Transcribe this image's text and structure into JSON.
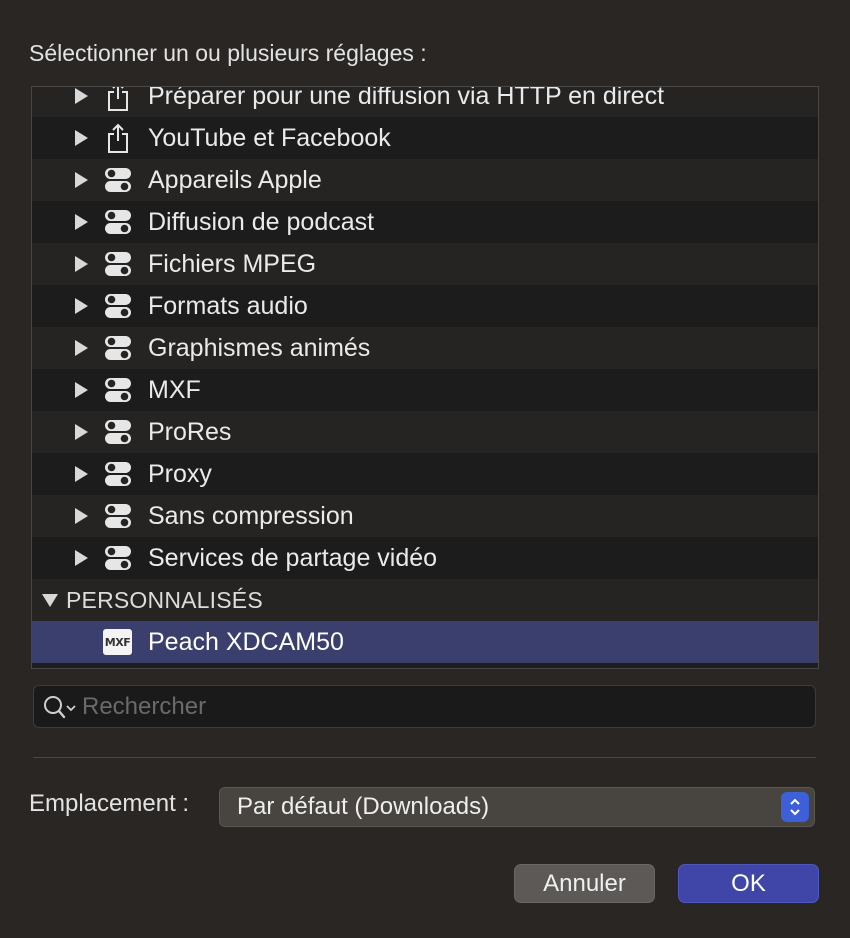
{
  "header": {
    "title": "Sélectionner un ou plusieurs réglages :"
  },
  "presets": [
    {
      "label": "Préparer pour une diffusion via HTTP en direct",
      "icon": "share-icon"
    },
    {
      "label": "YouTube et Facebook",
      "icon": "share-icon"
    },
    {
      "label": "Appareils Apple",
      "icon": "toggle-preset-icon"
    },
    {
      "label": "Diffusion de podcast",
      "icon": "toggle-preset-icon"
    },
    {
      "label": "Fichiers MPEG",
      "icon": "toggle-preset-icon"
    },
    {
      "label": "Formats audio",
      "icon": "toggle-preset-icon"
    },
    {
      "label": "Graphismes animés",
      "icon": "toggle-preset-icon"
    },
    {
      "label": "MXF",
      "icon": "toggle-preset-icon"
    },
    {
      "label": "ProRes",
      "icon": "toggle-preset-icon"
    },
    {
      "label": "Proxy",
      "icon": "toggle-preset-icon"
    },
    {
      "label": "Sans compression",
      "icon": "toggle-preset-icon"
    },
    {
      "label": "Services de partage vidéo",
      "icon": "toggle-preset-icon"
    }
  ],
  "custom_section": {
    "label": "PERSONNALISÉS",
    "items": [
      {
        "label": "Peach XDCAM50",
        "badge": "MXF",
        "selected": true
      }
    ]
  },
  "search": {
    "placeholder": "Rechercher",
    "value": ""
  },
  "location": {
    "label": "Emplacement :",
    "value": "Par défaut (Downloads)"
  },
  "buttons": {
    "cancel": "Annuler",
    "ok": "OK"
  },
  "colors": {
    "selection": "#3b3f6e",
    "ok_button": "#3f46a8",
    "accent": "#3d5fd8"
  }
}
